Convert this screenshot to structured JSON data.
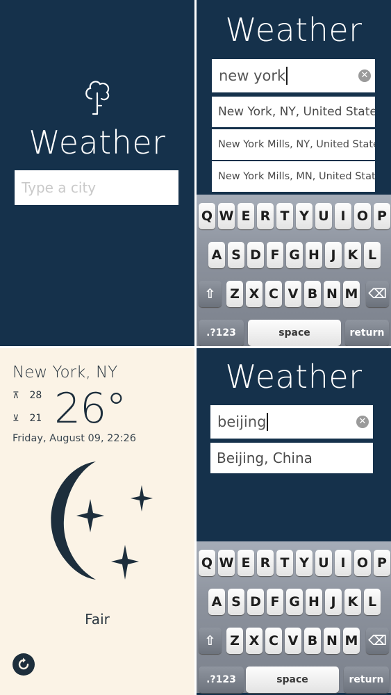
{
  "splash": {
    "title": "Weather",
    "input_placeholder": "Type a city"
  },
  "search_ny": {
    "title": "Weather",
    "query": "new york",
    "suggestions": [
      "New York, NY, United States",
      "New York Mills, NY, United States",
      "New York Mills, MN, United States"
    ]
  },
  "search_beijing": {
    "title": "Weather",
    "query": "beijing",
    "suggestions": [
      "Beijing, China"
    ]
  },
  "keyboard": {
    "row1": [
      "Q",
      "W",
      "E",
      "R",
      "T",
      "Y",
      "U",
      "I",
      "O",
      "P"
    ],
    "row2": [
      "A",
      "S",
      "D",
      "F",
      "G",
      "H",
      "J",
      "K",
      "L"
    ],
    "row3": [
      "Z",
      "X",
      "C",
      "V",
      "B",
      "N",
      "M"
    ],
    "shift_glyph": "⇧",
    "delete_glyph": "⌫",
    "numbers_label": ".?123",
    "space_label": "space",
    "return_label": "return"
  },
  "forecast": {
    "city": "New York, NY",
    "high": "28",
    "low": "21",
    "high_arrow": "⊼",
    "low_arrow": "⊻",
    "temperature": "26°",
    "datetime": "Friday, August 09, 22:26",
    "condition": "Fair",
    "icon": "moon-stars-icon"
  },
  "colors": {
    "navy": "#15314b",
    "cream": "#fbf3e6",
    "icon_dark": "#1d2e3c"
  }
}
